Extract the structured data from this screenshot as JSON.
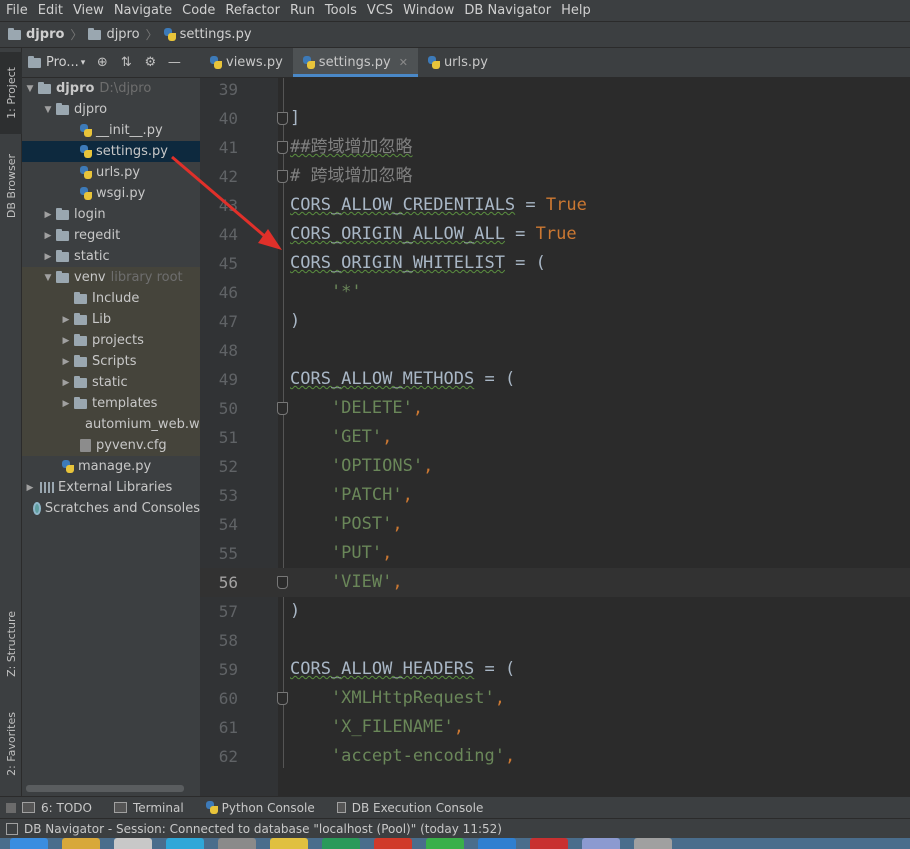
{
  "menu": [
    "File",
    "Edit",
    "View",
    "Navigate",
    "Code",
    "Refactor",
    "Run",
    "Tools",
    "VCS",
    "Window",
    "DB Navigator",
    "Help"
  ],
  "breadcrumb": [
    "djpro",
    "djpro",
    "settings.py"
  ],
  "left_strip": {
    "project_tab": "1: Project",
    "db_browser_tab": "DB Browser",
    "structure_tab": "Z: Structure",
    "favorites_tab": "2: Favorites"
  },
  "project": {
    "title": "Pro...",
    "tree": [
      {
        "label": "djpro",
        "hint": "D:\\djpro"
      },
      {
        "label": "djpro"
      },
      {
        "label": "__init__.py"
      },
      {
        "label": "settings.py"
      },
      {
        "label": "urls.py"
      },
      {
        "label": "wsgi.py"
      },
      {
        "label": "login"
      },
      {
        "label": "regedit"
      },
      {
        "label": "static"
      },
      {
        "label": "venv",
        "hint": "library root"
      },
      {
        "label": "Include"
      },
      {
        "label": "Lib"
      },
      {
        "label": "projects"
      },
      {
        "label": "Scripts"
      },
      {
        "label": "static"
      },
      {
        "label": "templates"
      },
      {
        "label": "automium_web.ws"
      },
      {
        "label": "pyvenv.cfg"
      },
      {
        "label": "manage.py"
      },
      {
        "label": "External Libraries"
      },
      {
        "label": "Scratches and Consoles"
      }
    ]
  },
  "tabs": [
    {
      "label": "views.py"
    },
    {
      "label": "settings.py",
      "close": "✕"
    },
    {
      "label": "urls.py"
    }
  ],
  "editor": {
    "current_line": "56",
    "lines": [
      {
        "n": "39"
      },
      {
        "n": "40",
        "t": "]"
      },
      {
        "n": "41",
        "t": "##跨域增加忽略"
      },
      {
        "n": "42",
        "t": "# 跨域增加忽略"
      },
      {
        "n": "43",
        "a": "CORS_ALLOW_CREDENTIALS",
        "b": " = ",
        "c": "True"
      },
      {
        "n": "44",
        "a": "CORS_ORIGIN_ALLOW_ALL",
        "b": " = ",
        "c": "True"
      },
      {
        "n": "45",
        "a": "CORS_ORIGIN_WHITELIST",
        "b": " = ("
      },
      {
        "n": "46",
        "s": "    '*'"
      },
      {
        "n": "47",
        "t": ")"
      },
      {
        "n": "48"
      },
      {
        "n": "49",
        "a": "CORS_ALLOW_METHODS",
        "b": " = ("
      },
      {
        "n": "50",
        "s": "    'DELETE'",
        "p": ","
      },
      {
        "n": "51",
        "s": "    'GET'",
        "p": ","
      },
      {
        "n": "52",
        "s": "    'OPTIONS'",
        "p": ","
      },
      {
        "n": "53",
        "s": "    'PATCH'",
        "p": ","
      },
      {
        "n": "54",
        "s": "    'POST'",
        "p": ","
      },
      {
        "n": "55",
        "s": "    'PUT'",
        "p": ","
      },
      {
        "n": "56",
        "s": "    'VIEW'",
        "p": ","
      },
      {
        "n": "57",
        "t": ")"
      },
      {
        "n": "58"
      },
      {
        "n": "59",
        "a": "CORS_ALLOW_HEADERS",
        "b": " = ("
      },
      {
        "n": "60",
        "s": "    'XMLHttpRequest'",
        "p": ","
      },
      {
        "n": "61",
        "s": "    'X_FILENAME'",
        "p": ","
      },
      {
        "n": "62",
        "s": "    'accept-encoding'",
        "p": ","
      }
    ]
  },
  "bottom_tools": [
    "6: TODO",
    "Terminal",
    "Python Console",
    "DB Execution Console"
  ],
  "status": "DB Navigator - Session: Connected to database \"localhost (Pool)\" (today 11:52)",
  "colors": {
    "keyword": "#cc7832",
    "string": "#6a8759",
    "comment": "#808080",
    "identifier": "#a9b7c6",
    "selection": "#0d293e",
    "tab_underline": "#4a88c7",
    "annotation_arrow": "#e0302a"
  }
}
